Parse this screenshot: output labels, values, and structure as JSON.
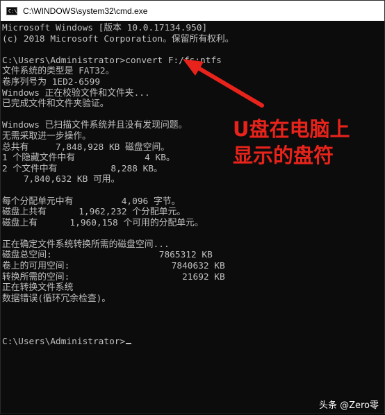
{
  "window": {
    "title": "C:\\WINDOWS\\system32\\cmd.exe",
    "icon_glyph": "C:\\"
  },
  "console": {
    "lines": [
      "Microsoft Windows [版本 10.0.17134.950]",
      "(c) 2018 Microsoft Corporation。保留所有权利。",
      "",
      "C:\\Users\\Administrator>convert F:/fs:ntfs",
      "文件系统的类型是 FAT32。",
      "卷序列号为 1ED2-6599",
      "Windows 正在校验文件和文件夹...",
      "已完成文件和文件夹验证。",
      "",
      "Windows 已扫描文件系统并且没有发现问题。",
      "无需采取进一步操作。",
      "总共有     7,848,928 KB 磁盘空间。",
      "1 个隐藏文件中有             4 KB。",
      "2 个文件中有          8,288 KB。",
      "    7,840,632 KB 可用。",
      "",
      "每个分配单元中有         4,096 字节。",
      "磁盘上共有      1,962,232 个分配单元。",
      "磁盘上有      1,960,158 个可用的分配单元。",
      "",
      "正在确定文件系统转换所需的磁盘空间...",
      "磁盘总空间:                    7865312 KB",
      "卷上的可用空间:                   7840632 KB",
      "转换所需的空间:                     21692 KB",
      "正在转换文件系统",
      "数据错误(循环冗余检查)。",
      "",
      "",
      "",
      "C:\\Users\\Administrator>"
    ]
  },
  "annotation": {
    "line1": "U盘在电脑上",
    "line2": "显示的盘符",
    "color": "#e8231b"
  },
  "watermark": {
    "text": "头条 @Zero零"
  }
}
